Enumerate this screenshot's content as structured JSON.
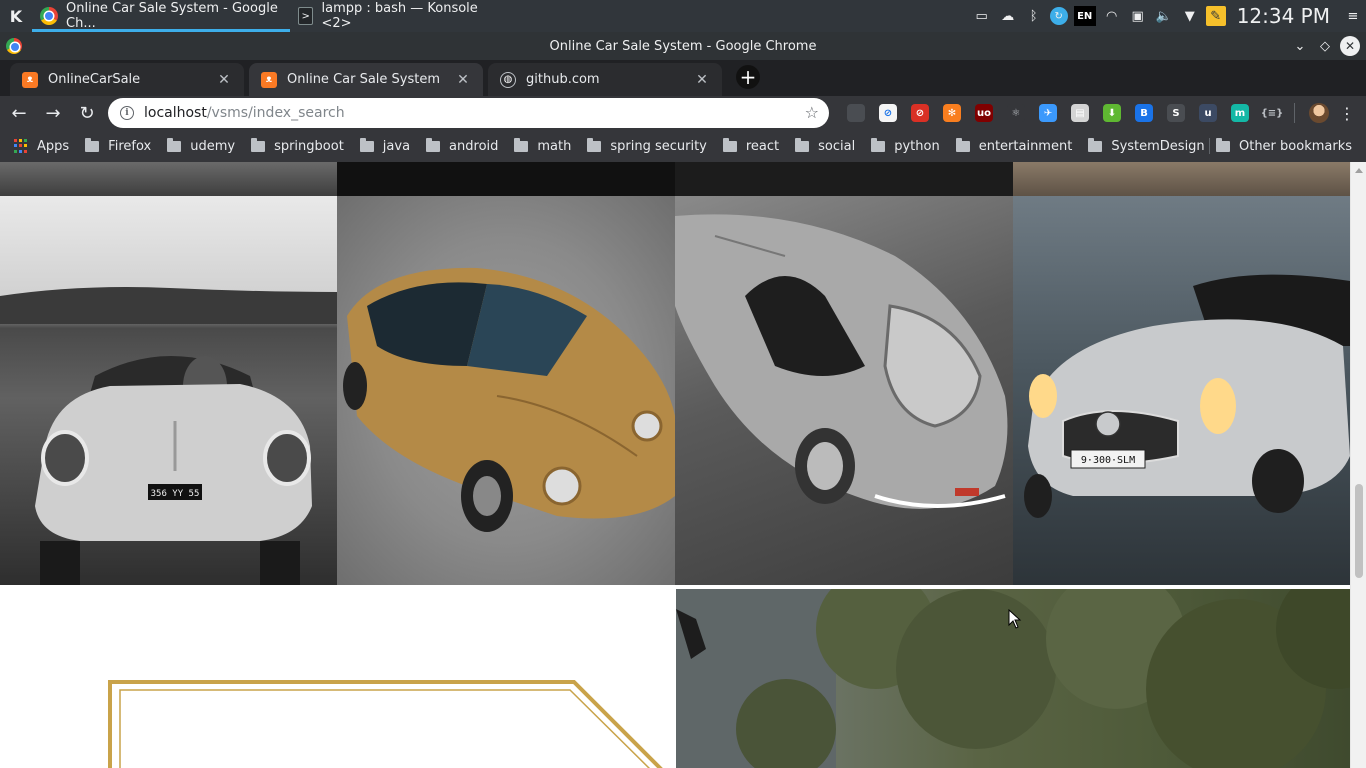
{
  "taskbar": {
    "tasks": [
      {
        "label": "Online Car Sale System - Google Ch..."
      },
      {
        "label": "lampp : bash — Konsole <2>"
      }
    ],
    "tray": {
      "keyboard_layout": "EN",
      "clock": "12:34 PM"
    }
  },
  "window": {
    "title": "Online Car Sale System - Google Chrome"
  },
  "tabs": [
    {
      "label": "OnlineCarSale"
    },
    {
      "label": "Online Car Sale System"
    },
    {
      "label": "github.com"
    }
  ],
  "omnibox": {
    "host": "localhost",
    "path": "/vsms/index_search"
  },
  "extensions": [
    {
      "name": "pocket",
      "label": "",
      "color": "#4a4d52"
    },
    {
      "name": "privacy-badger",
      "label": "⊘",
      "color": "#f5f5f5"
    },
    {
      "name": "blocker",
      "label": "⊘",
      "color": "#d93025"
    },
    {
      "name": "orange-ext",
      "label": "✻",
      "color": "#f97e1f"
    },
    {
      "name": "ublock",
      "label": "uo",
      "color": "#800000"
    },
    {
      "name": "react-devtools",
      "label": "⚛",
      "color": "#35363a"
    },
    {
      "name": "plane-ext",
      "label": "✈",
      "color": "#3b99fc"
    },
    {
      "name": "printer-ext",
      "label": "▤",
      "color": "#d4d4d4"
    },
    {
      "name": "download-ext",
      "label": "⬇",
      "color": "#5fb832"
    },
    {
      "name": "b-ext",
      "label": "B",
      "color": "#1a73e8"
    },
    {
      "name": "s-ext",
      "label": "S",
      "color": "#4a4d52"
    },
    {
      "name": "u-ext",
      "label": "u",
      "color": "#3c4a63"
    },
    {
      "name": "m-ext",
      "label": "m",
      "color": "#14b8a6"
    },
    {
      "name": "json-ext",
      "label": "{≡}",
      "color": "#35363a"
    }
  ],
  "bookmarks": [
    {
      "label": "Apps",
      "type": "apps"
    },
    {
      "label": "Firefox",
      "type": "folder"
    },
    {
      "label": "udemy",
      "type": "folder"
    },
    {
      "label": "springboot",
      "type": "folder"
    },
    {
      "label": "java",
      "type": "folder"
    },
    {
      "label": "android",
      "type": "folder"
    },
    {
      "label": "math",
      "type": "folder"
    },
    {
      "label": "spring security",
      "type": "folder"
    },
    {
      "label": "react",
      "type": "folder"
    },
    {
      "label": "social",
      "type": "folder"
    },
    {
      "label": "python",
      "type": "folder"
    },
    {
      "label": "entertainment",
      "type": "folder"
    },
    {
      "label": "SystemDesign",
      "type": "folder"
    }
  ],
  "other_bookmarks": "Other bookmarks",
  "gallery": {
    "photos": [
      {
        "subject": "classic convertible sports car, black and white",
        "plate": "356 YY 55"
      },
      {
        "subject": "bronze classic coupe, top view"
      },
      {
        "subject": "silver classic coupe, top view"
      },
      {
        "subject": "silver classic roadster with headlights on",
        "plate": "9·300·SLM"
      }
    ]
  },
  "colors": {
    "accent_gold": "#c9a34a",
    "kde_panel": "#31363b",
    "chrome_dark": "#35363a",
    "kde_active_blue": "#3daee9"
  }
}
